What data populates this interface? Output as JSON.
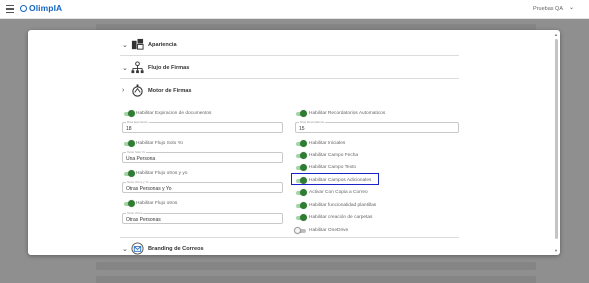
{
  "app": {
    "brand": "OlimpIA",
    "user": "Pruebas QA"
  },
  "sections": {
    "apariencia": "Apariencia",
    "flujo_firmas": "Flujo de Firmas",
    "motor_firmas": "Motor de Firmas",
    "branding_correos": "Branding de Correos"
  },
  "left": {
    "expiracion_label": "Habilitar Expiracion de documentos",
    "expiracion_field_label": "Días Expiración",
    "expiracion_value": "18",
    "flujo_solo_yo_label": "Habilitar Flujo Solo Yo",
    "flujo_solo_yo_field_label": "Texto Solo Yo",
    "flujo_solo_yo_value": "Una Persona",
    "flujo_otros_y_yo_label": "Habilitar Flujo otros y yo",
    "flujo_otros_y_yo_field_label": "Texto Otros y Yo",
    "flujo_otros_y_yo_value": "Otras Personas y Yo",
    "flujo_otros_label": "Habilitar Flujo otros",
    "flujo_otros_field_label": "Texto Otros",
    "flujo_otros_value": "Otras Personas"
  },
  "right": {
    "recordatorios_label": "Habilitar Recordatorios Automaticos",
    "recordatorios_field_label": "Días Recordatorio",
    "recordatorios_value": "15",
    "iniciales_label": "Habilitar Iniciales",
    "campo_fecha_label": "Habilitar Campo Fecha",
    "campo_texto_label": "Habilitar Campo Texto",
    "campos_adicionales_label": "Habilitar Campos Adicionales",
    "copia_correo_label": "Activar Con Copia a Correo",
    "plantillas_label": "Habilitar funcionalidad plantillas",
    "carpetas_label": "Habilitar creación de carpetas",
    "onedrive_label": "Habilitar OneDrive"
  },
  "toggles": {
    "expiracion": true,
    "flujo_solo_yo": true,
    "flujo_otros_y_yo": true,
    "flujo_otros": true,
    "recordatorios": true,
    "iniciales": true,
    "campo_fecha": true,
    "campo_texto": true,
    "campos_adicionales": true,
    "copia_correo": true,
    "plantillas": true,
    "carpetas": true,
    "onedrive": false
  },
  "colors": {
    "accent": "#1565c0",
    "toggle_on": "#2e7d32",
    "highlight": "#1a23c9"
  }
}
